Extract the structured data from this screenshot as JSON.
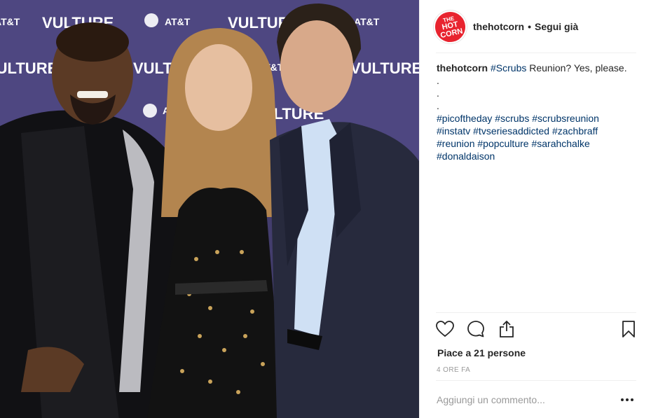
{
  "post": {
    "image_alt": "",
    "backdrop_logos": [
      "VULTURE",
      "AT&T"
    ]
  },
  "header": {
    "avatar_text_top": "THE",
    "avatar_text_mid": "HOT",
    "avatar_text_bottom": "CORN",
    "username": "thehotcorn",
    "separator": "•",
    "follow_label": "Segui già"
  },
  "caption": {
    "username": "thehotcorn",
    "first_hashtag": "#Scrubs",
    "text": " Reunion? Yes, please.",
    "dots": [
      ".",
      ".",
      "."
    ],
    "hashtags": [
      "#picoftheday",
      "#scrubs",
      "#scrubsreunion",
      "#instatv",
      "#tvseriesaddicted",
      "#zachbraff",
      "#reunion",
      "#popculture",
      "#sarahchalke",
      "#donaldaison"
    ]
  },
  "actions": {
    "icons": [
      "heart-icon",
      "comment-icon",
      "share-icon",
      "bookmark-icon"
    ]
  },
  "likes": {
    "label": "Piace a 21 persone"
  },
  "timestamp": {
    "label": "4 ore fa"
  },
  "comment": {
    "placeholder": "Aggiungi un commento...",
    "more_label": "•••"
  },
  "colors": {
    "hashtag": "#003569",
    "text": "#262626",
    "muted": "#999999",
    "divider": "#efefef",
    "brand_avatar": "#e8242f"
  }
}
